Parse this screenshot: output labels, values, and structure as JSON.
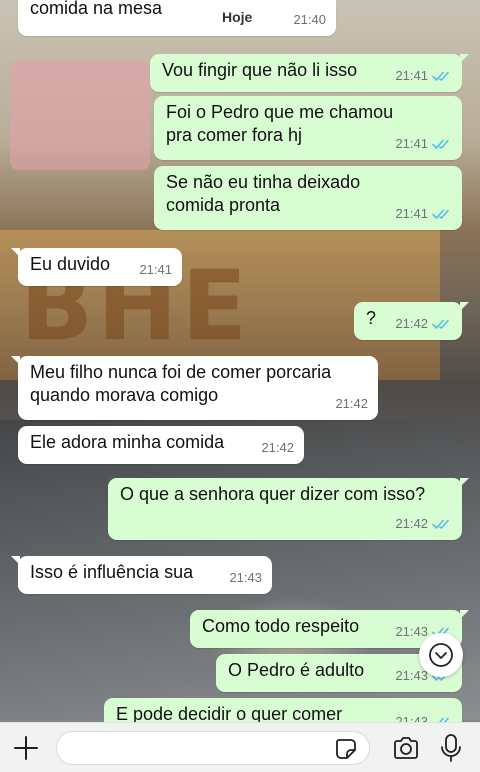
{
  "conversation": {
    "date_label": "Hoje",
    "scroll_down_icon": "chevron-down-icon",
    "messages": [
      {
        "dir": "in",
        "text": "comida na mesa",
        "time": "21:40"
      },
      {
        "dir": "out",
        "text": "Vou fingir que não li isso",
        "time": "21:41",
        "status": "read"
      },
      {
        "dir": "out",
        "text": "Foi o Pedro que me chamou pra comer fora hj",
        "time": "21:41",
        "status": "read"
      },
      {
        "dir": "out",
        "text": "Se não eu tinha deixado comida pronta",
        "time": "21:41",
        "status": "read"
      },
      {
        "dir": "in",
        "text": "Eu duvido",
        "time": "21:41"
      },
      {
        "dir": "out",
        "text": "?",
        "time": "21:42",
        "status": "read"
      },
      {
        "dir": "in",
        "text": "Meu filho nunca foi de comer porcaria quando morava comigo",
        "time": "21:42"
      },
      {
        "dir": "in",
        "text": "Ele adora minha comida",
        "time": "21:42"
      },
      {
        "dir": "out",
        "text": "O que a senhora quer dizer com isso?",
        "time": "21:42",
        "status": "read"
      },
      {
        "dir": "in",
        "text": "Isso é influência sua",
        "time": "21:43"
      },
      {
        "dir": "out",
        "text": "Como todo respeito",
        "time": "21:43",
        "status": "read"
      },
      {
        "dir": "out",
        "text": "O Pedro é adulto",
        "time": "21:43",
        "status": "read"
      },
      {
        "dir": "out",
        "text": "E pode decidir o quer comer",
        "time": "21:43",
        "status": "read"
      }
    ]
  },
  "composer": {
    "message_value": "",
    "icons": [
      "plus-icon",
      "sticker-icon",
      "camera-icon",
      "microphone-icon"
    ]
  },
  "colors": {
    "incoming_bubble": "#ffffff",
    "outgoing_bubble": "#d9fdd3",
    "read_ticks": "#53bdeb",
    "timestamp": "#6b7175"
  }
}
